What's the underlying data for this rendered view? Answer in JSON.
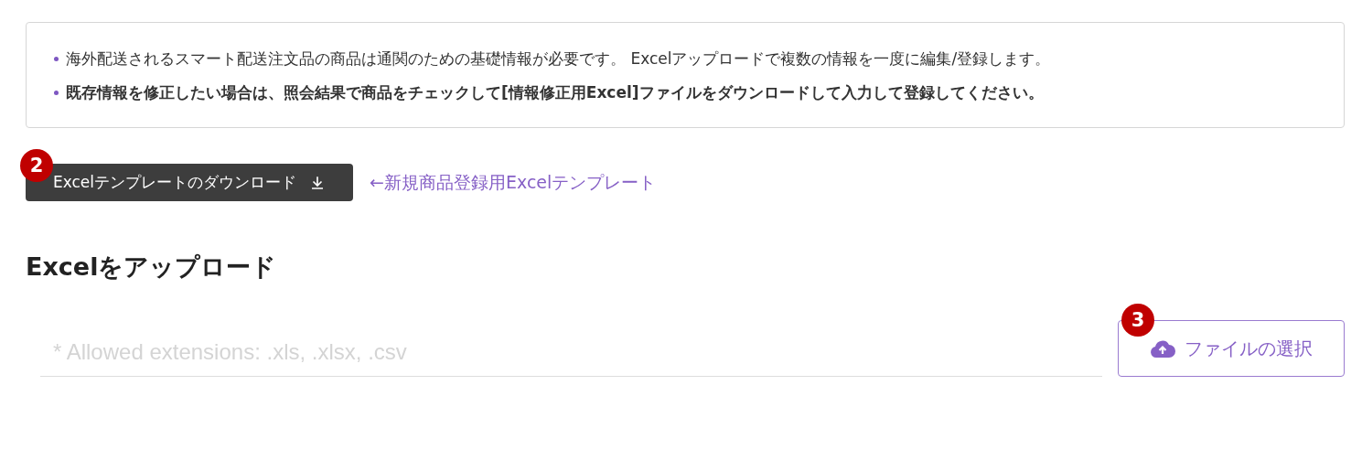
{
  "notice": {
    "items": [
      {
        "text": "海外配送されるスマート配送注文品の商品は通関のための基礎情報が必要です。 Excelアップロードで複数の情報を一度に編集/登録します。",
        "bold": false
      },
      {
        "text": "既存情報を修正したい場合は、照会結果で商品をチェックして[情報修正用Excel]ファイルをダウンロードして入力して登録してください。",
        "bold": true
      }
    ]
  },
  "template": {
    "badge": "2",
    "button": "Excelテンプレートのダウンロード",
    "link": "←新規商品登録用Excelテンプレート"
  },
  "upload": {
    "heading": "Excelをアップロード",
    "placeholder": "* Allowed extensions: .xls, .xlsx, .csv",
    "badge": "3",
    "button": "ファイルの選択"
  }
}
